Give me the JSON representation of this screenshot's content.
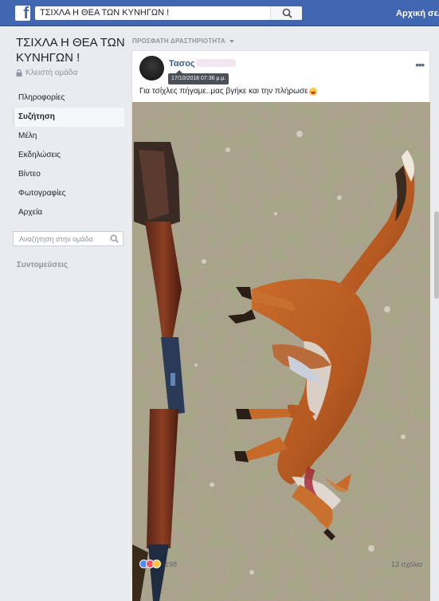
{
  "topbar": {
    "logo": "f",
    "search_value": "ΤΣΙΧΛΑ Η ΘΕΑ ΤΩΝ ΚΥΝΗΓΩΝ !",
    "home_link": "Αρχική σελίδα"
  },
  "sidebar": {
    "group_name": "ΤΣΙΧΛΑ Η ΘΕΑ ΤΩΝ ΚΥΝΗΓΩΝ !",
    "privacy": "Κλειστή ομάδα",
    "nav": [
      {
        "label": "Πληροφορίες"
      },
      {
        "label": "Συζήτηση",
        "active": true
      },
      {
        "label": "Μέλη"
      },
      {
        "label": "Εκδηλώσεις"
      },
      {
        "label": "Βίντεο"
      },
      {
        "label": "Φωτογραφίες"
      },
      {
        "label": "Αρχεία"
      }
    ],
    "search_placeholder": "Αναζήτηση στην ομάδα",
    "shortcuts_label": "Συντομεύσεις"
  },
  "feed": {
    "header": "ΠΡΟΣΦΑΤΗ ΔΡΑΣΤΗΡΙΟΤΗΤΑ"
  },
  "post": {
    "author": "Τασος",
    "timestamp": "17/10/2018 07:36 μ.μ.",
    "caption": "Για τσίχλες πήγαμε..μας βγήκε και την πλήρωσε",
    "reaction_count": "198",
    "comments": "13 σχόλια"
  },
  "colors": {
    "brand": "#4267b2",
    "link": "#385898",
    "background": "#e9ebee"
  }
}
